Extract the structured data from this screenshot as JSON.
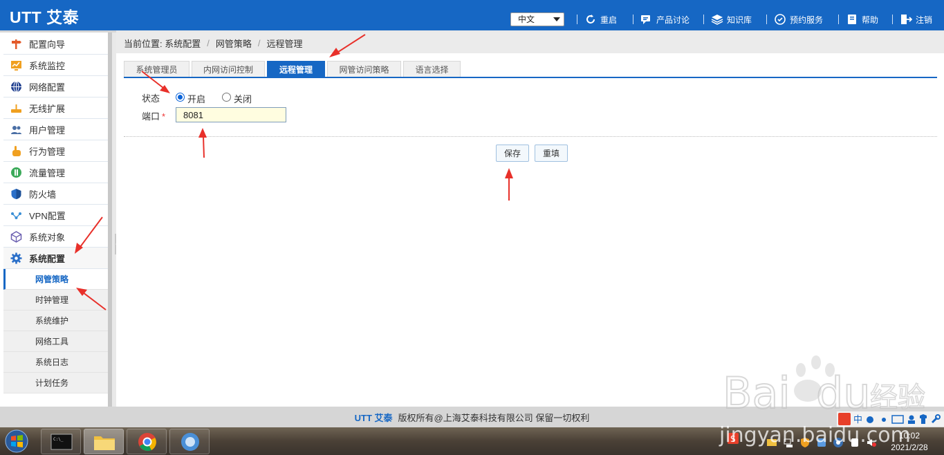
{
  "header": {
    "logo": "UTT 艾泰",
    "language": "中文",
    "nav": [
      "重启",
      "产品讨论",
      "知识库",
      "预约服务",
      "帮助",
      "注销"
    ]
  },
  "sidebar": {
    "items": [
      "配置向导",
      "系统监控",
      "网络配置",
      "无线扩展",
      "用户管理",
      "行为管理",
      "流量管理",
      "防火墙",
      "VPN配置",
      "系统对象",
      "系统配置"
    ],
    "sub_items": [
      "网管策略",
      "时钟管理",
      "系统维护",
      "网络工具",
      "系统日志",
      "计划任务"
    ]
  },
  "breadcrumb": {
    "prefix": "当前位置:",
    "parts": [
      "系统配置",
      "网管策略",
      "远程管理"
    ]
  },
  "tabs": [
    "系统管理员",
    "内网访问控制",
    "远程管理",
    "网管访问策略",
    "语言选择"
  ],
  "form": {
    "status_label": "状态",
    "status_on": "开启",
    "status_off": "关闭",
    "port_label": "端口",
    "required_mark": "*",
    "port_value": "8081"
  },
  "buttons": {
    "save": "保存",
    "reset": "重填"
  },
  "footer": {
    "brand": "UTT 艾泰",
    "copyright": "版权所有@上海艾泰科技有限公司 保留一切权利"
  },
  "taskbar": {
    "time": "10:02",
    "date": "2021/2/28"
  },
  "watermark": {
    "text": "jingyan.baidu.com"
  },
  "colors": {
    "brand_blue": "#1667c4",
    "annotation_red": "#e8302a"
  }
}
